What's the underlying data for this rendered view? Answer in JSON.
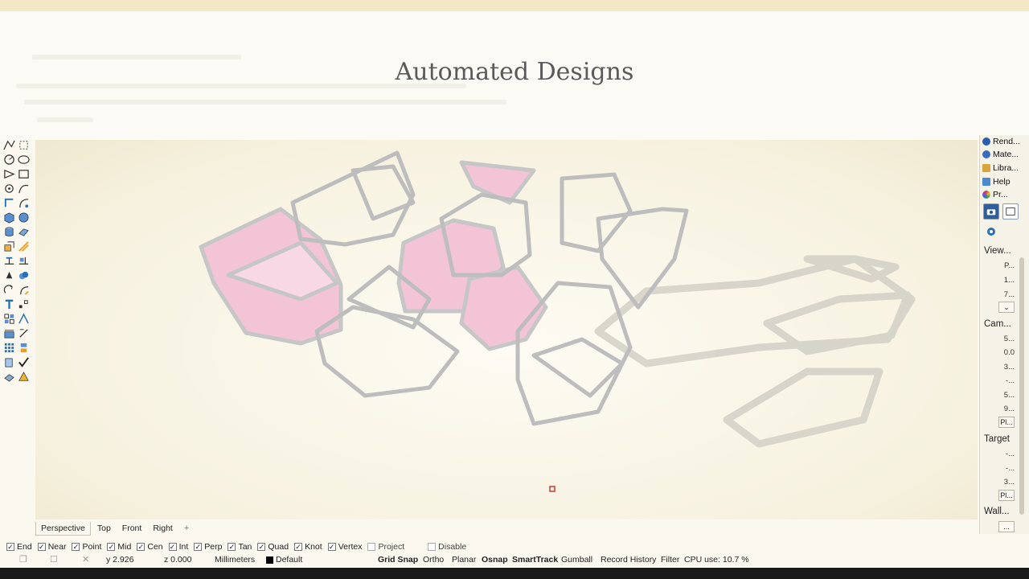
{
  "slide": {
    "title": "Automated Designs"
  },
  "viewport_tabs": [
    "Perspective",
    "Top",
    "Front",
    "Right"
  ],
  "viewport_tab_add": "+",
  "right_panel": {
    "tabs": [
      {
        "label": "Rend...",
        "icon": "render-icon",
        "color": "#2b5fae"
      },
      {
        "label": "Mate...",
        "icon": "material-icon",
        "color": "#3a6db8"
      },
      {
        "label": "Libra...",
        "icon": "library-icon",
        "color": "#d9a43a"
      },
      {
        "label": "Help",
        "icon": "help-icon",
        "color": "#4a8ad0"
      },
      {
        "label": "Pr...",
        "icon": "properties-icon",
        "color": "#d04a4a"
      }
    ],
    "view_section": "View...",
    "view_fields": [
      "P...",
      "1...",
      "7..."
    ],
    "view_expand": "⌄",
    "camera_section": "Cam...",
    "camera_fields": [
      "5...",
      "0.0",
      "3...",
      "-...",
      "5...",
      "9..."
    ],
    "camera_button": "Pl...",
    "target_section": "Target",
    "target_fields": [
      "-...",
      "-...",
      "3..."
    ],
    "target_button": "Pl...",
    "wallpaper_section": "Wall...",
    "wallpaper_button": "..."
  },
  "osnaps": [
    {
      "label": "End",
      "checked": true
    },
    {
      "label": "Near",
      "checked": true
    },
    {
      "label": "Point",
      "checked": true
    },
    {
      "label": "Mid",
      "checked": true
    },
    {
      "label": "Cen",
      "checked": true
    },
    {
      "label": "Int",
      "checked": true
    },
    {
      "label": "Perp",
      "checked": true
    },
    {
      "label": "Tan",
      "checked": true
    },
    {
      "label": "Quad",
      "checked": true
    },
    {
      "label": "Knot",
      "checked": true
    },
    {
      "label": "Vertex",
      "checked": true
    },
    {
      "label": "Project",
      "checked": false
    },
    {
      "label": "Disable",
      "checked": false
    }
  ],
  "status": {
    "y": "y 2.926",
    "z": "z 0.000",
    "units": "Millimeters",
    "layer": "Default",
    "layer_color": "#000000",
    "grid_snap": "Grid Snap",
    "ortho": "Ortho",
    "planar": "Planar",
    "osnap": "Osnap",
    "smarttrack": "SmartTrack",
    "gumball": "Gumball",
    "record_history": "Record History",
    "filter": "Filter",
    "cpu": "CPU use: 10.7 %"
  },
  "colors": {
    "accent_pink": "#f5c8d8",
    "frame_gray": "#bcbcbc"
  }
}
